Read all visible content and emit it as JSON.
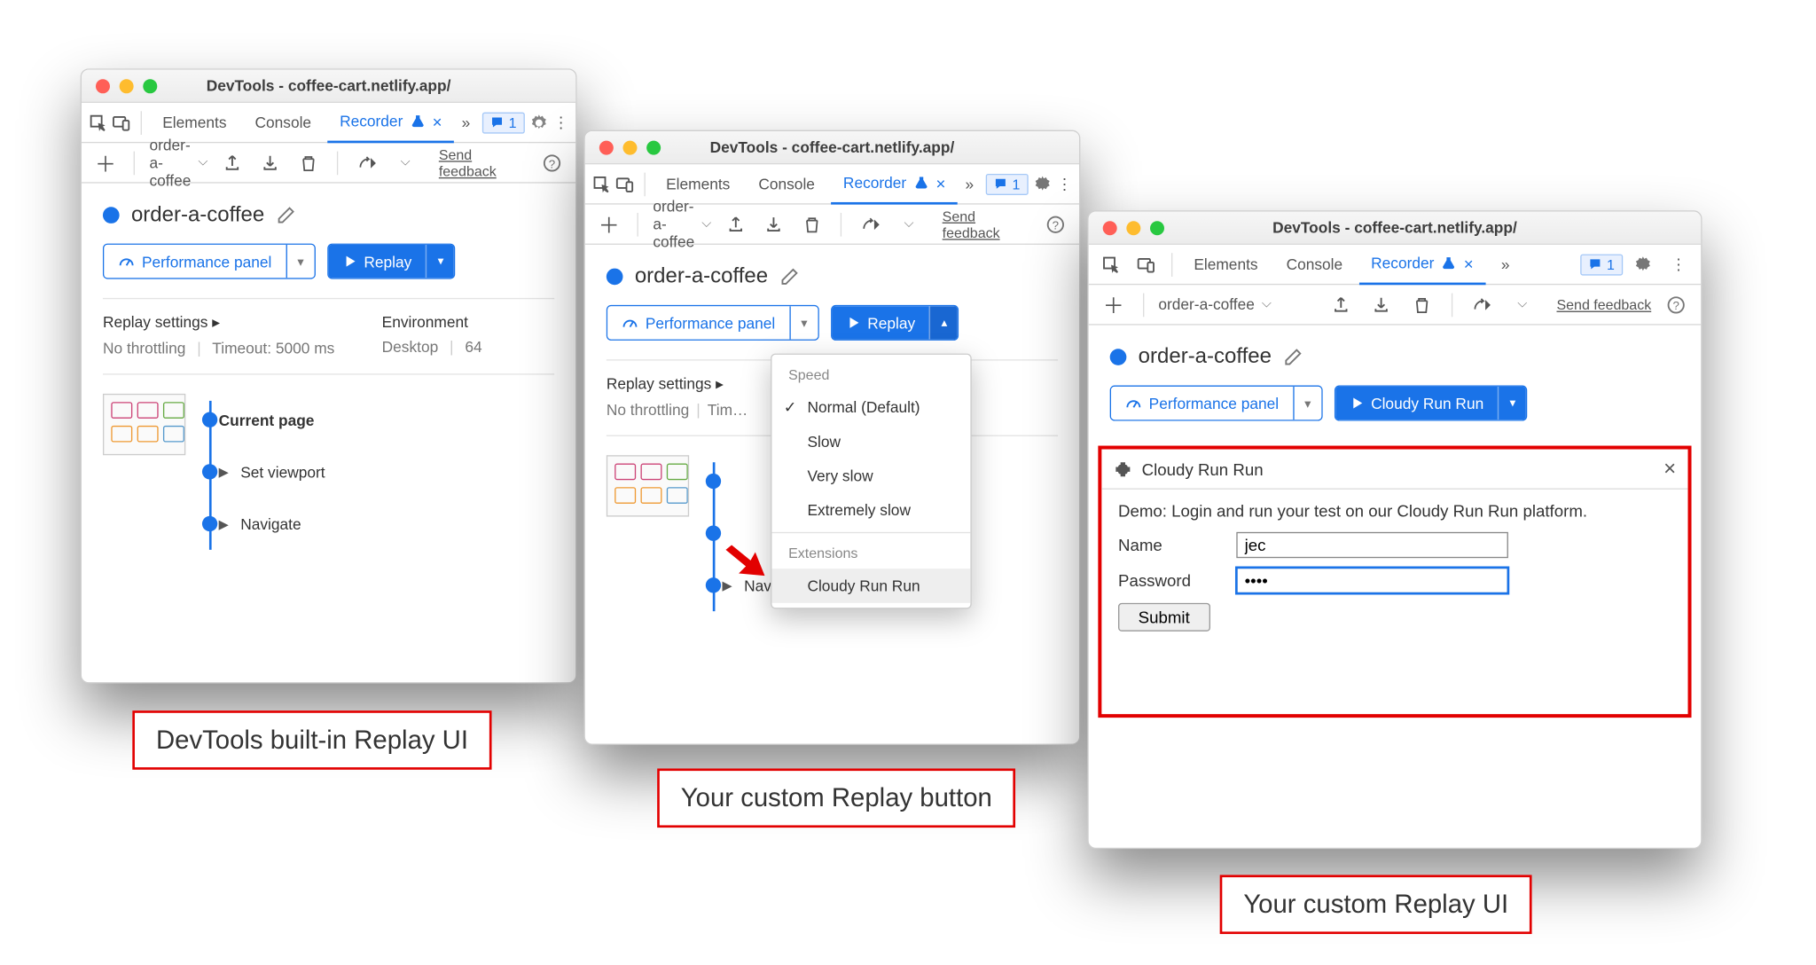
{
  "window_title": "DevTools - coffee-cart.netlify.app/",
  "tabs": {
    "elements": "Elements",
    "console": "Console",
    "recorder": "Recorder"
  },
  "issues_count": "1",
  "recording_name": "order-a-coffee",
  "feedback": "Send feedback",
  "buttons": {
    "perf_panel": "Performance panel",
    "replay": "Replay",
    "cloudy_run": "Cloudy Run Run"
  },
  "replay_settings": {
    "title": "Replay settings",
    "throttling": "No throttling",
    "timeout": "Timeout: 5000 ms"
  },
  "environment": {
    "title": "Environment",
    "env_desktop": "Desktop",
    "env_extra": "64"
  },
  "steps": {
    "current": "Current page",
    "viewport": "Set viewport",
    "navigate": "Navigate"
  },
  "menu": {
    "speed_head": "Speed",
    "normal": "Normal (Default)",
    "slow": "Slow",
    "very_slow": "Very slow",
    "extremely_slow": "Extremely slow",
    "ext_head": "Extensions",
    "cloudy": "Cloudy Run Run"
  },
  "plugin": {
    "title": "Cloudy Run Run",
    "desc": "Demo: Login and run your test on our Cloudy Run Run platform.",
    "name_label": "Name",
    "name_value": "jec",
    "pass_label": "Password",
    "pass_value": "••••",
    "submit": "Submit"
  },
  "captions": {
    "c1": "DevTools built-in Replay UI",
    "c2": "Your custom Replay button",
    "c3": "Your custom Replay UI"
  }
}
